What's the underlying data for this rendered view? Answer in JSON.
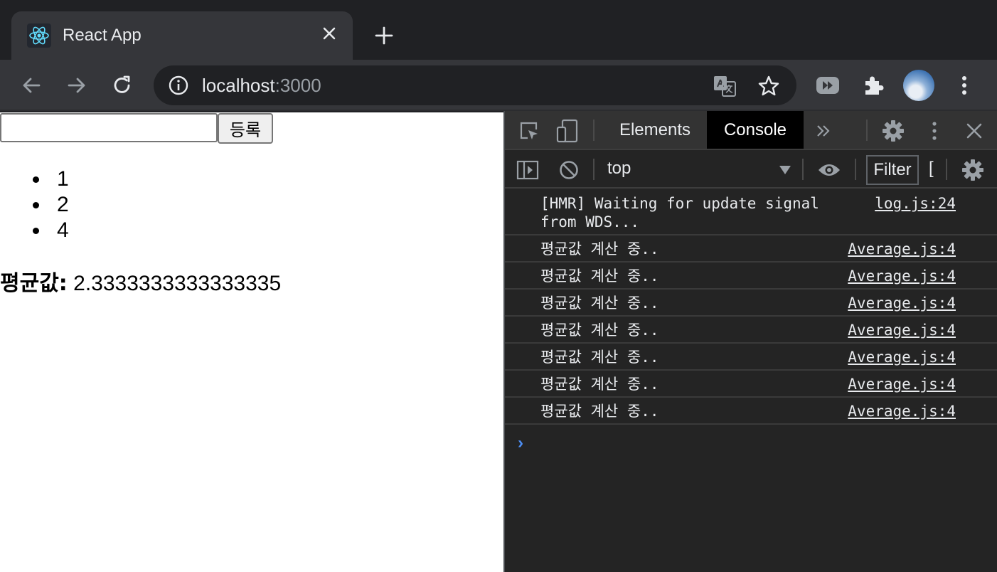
{
  "browser": {
    "tab_title": "React App",
    "url_host": "localhost",
    "url_port": ":3000"
  },
  "page": {
    "input_value": "",
    "register_button": "등록",
    "items": [
      "1",
      "2",
      "4"
    ],
    "average_label": "평균값:",
    "average_value": "2.3333333333333335"
  },
  "devtools": {
    "tabs": {
      "elements": "Elements",
      "console": "Console"
    },
    "context": "top",
    "filter_label": "Filter",
    "filter_extra": "[",
    "logs": [
      {
        "message": "[HMR] Waiting for update signal\nfrom WDS...",
        "source": "log.js:24"
      },
      {
        "message": "평균값 계산 중..",
        "source": "Average.js:4"
      },
      {
        "message": "평균값 계산 중..",
        "source": "Average.js:4"
      },
      {
        "message": "평균값 계산 중..",
        "source": "Average.js:4"
      },
      {
        "message": "평균값 계산 중..",
        "source": "Average.js:4"
      },
      {
        "message": "평균값 계산 중..",
        "source": "Average.js:4"
      },
      {
        "message": "평균값 계산 중..",
        "source": "Average.js:4"
      },
      {
        "message": "평균값 계산 중..",
        "source": "Average.js:4"
      }
    ],
    "prompt_symbol": "›"
  },
  "colors": {
    "tabstrip_bg": "#202124",
    "toolbar_bg": "#35363a",
    "devtools_bg": "#242424",
    "prompt_blue": "#4d8ff5"
  }
}
